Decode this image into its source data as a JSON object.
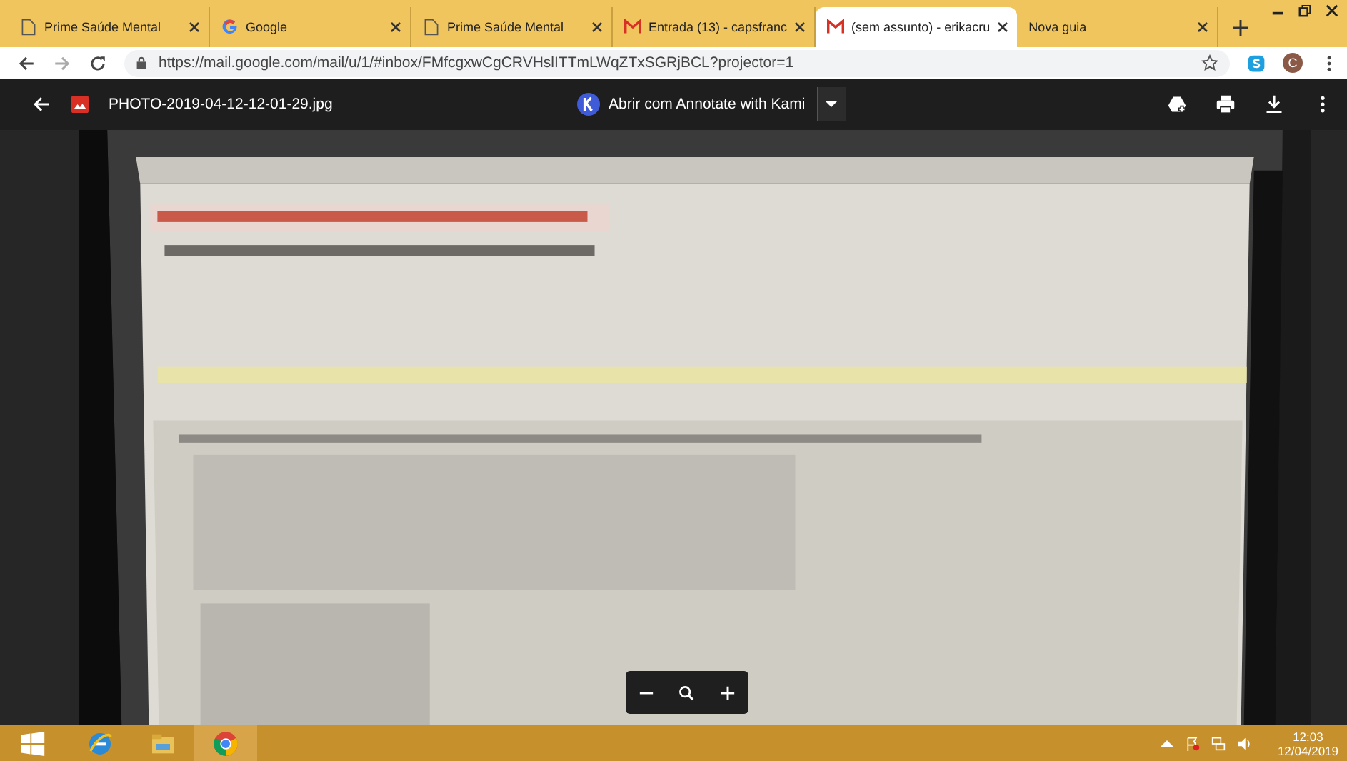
{
  "tabs": [
    {
      "label": "Prime Saúde Mental",
      "kind": "page",
      "selected": false
    },
    {
      "label": "Google",
      "kind": "google",
      "selected": false
    },
    {
      "label": "Prime Saúde Mental",
      "kind": "page",
      "selected": false
    },
    {
      "label": "Entrada (13) - capsfranc",
      "kind": "gmail",
      "selected": false
    },
    {
      "label": "(sem assunto) - erikacru",
      "kind": "gmail",
      "selected": true
    },
    {
      "label": "Nova guia",
      "kind": "none",
      "selected": false
    }
  ],
  "address_bar": {
    "url": "https://mail.google.com/mail/u/1/#inbox/FMfcgxwCgCRVHslITTmLWqZTxSGRjBCL?projector=1"
  },
  "profile": {
    "initial": "C"
  },
  "viewer": {
    "file_name": "PHOTO-2019-04-12-12-01-29.jpg",
    "open_with": "Abrir com Annotate with Kami"
  },
  "taskbar": {
    "time": "12:03",
    "date": "12/04/2019"
  }
}
